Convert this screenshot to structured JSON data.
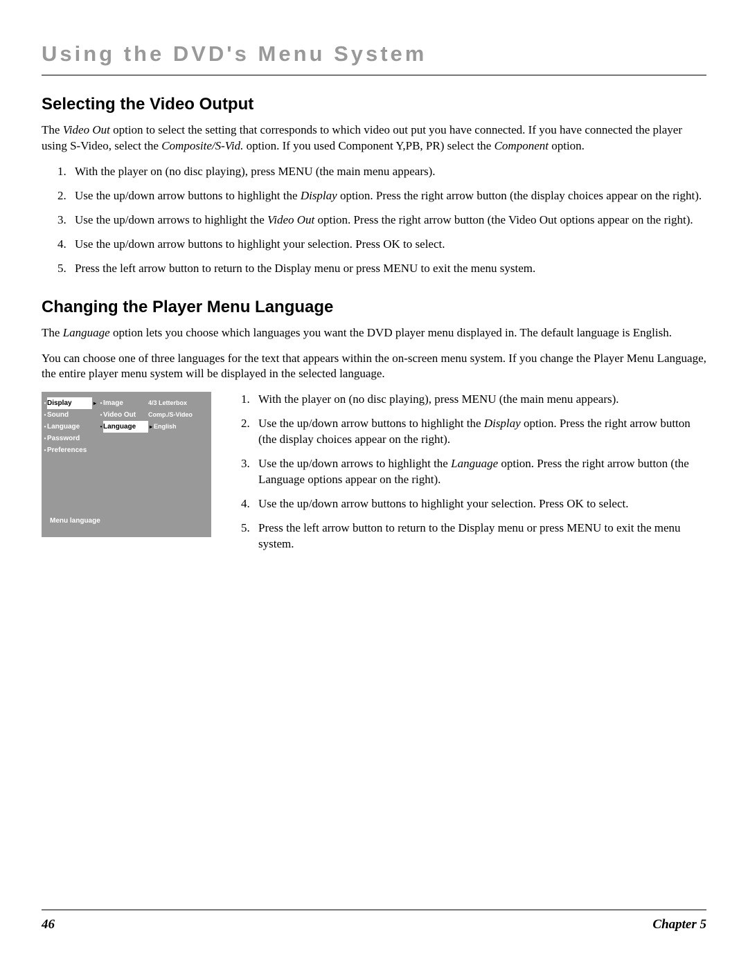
{
  "page_title": "Using the DVD's Menu System",
  "section1": {
    "heading": "Selecting the Video Output",
    "intro_pre": "The ",
    "intro_ital1": "Video Out",
    "intro_mid": " option to select the setting that corresponds to which video out put you have connected. If you have connected the player using S-Video, select the ",
    "intro_ital2": "Composite/S-Vid.",
    "intro_mid2": " option. If you used Component Y,PB, PR) select the ",
    "intro_ital3": "Component",
    "intro_end": " option.",
    "steps": {
      "s1": "With the player on (no disc playing), press MENU (the main menu appears).",
      "s2_a": "Use the up/down arrow buttons to highlight the ",
      "s2_i": "Display",
      "s2_b": " option. Press the right arrow button (the display choices appear on the right).",
      "s3_a": "Use the up/down arrows to highlight the ",
      "s3_i": "Video Out",
      "s3_b": " option. Press the right arrow button (the Video Out options appear on the right).",
      "s4": "Use the up/down arrow buttons to highlight your selection. Press OK to select.",
      "s5": "Press the left arrow button to return to the Display menu or press MENU to exit the menu system."
    }
  },
  "section2": {
    "heading": "Changing the Player Menu Language",
    "intro_pre": "The ",
    "intro_ital1": "Language",
    "intro_end": " option lets you choose which languages you want the DVD player menu displayed in. The default language is English.",
    "para2": "You can choose one of three languages for the text that appears within the on-screen menu system. If you change the Player Menu Language, the entire player menu system will be displayed in the selected language.",
    "steps": {
      "s1": "With the player on (no disc playing), press MENU (the main menu appears).",
      "s2_a": "Use the up/down arrow buttons to highlight the ",
      "s2_i": "Display",
      "s2_b": " option. Press the right arrow button (the display choices appear on the right).",
      "s3_a": "Use the up/down arrows to highlight the ",
      "s3_i": "Language",
      "s3_b": " option. Press the right arrow button (the Language options appear on the right).",
      "s4": "Use the up/down arrow buttons to highlight your selection. Press OK to select.",
      "s5": "Press the left arrow button to return to the Display menu or press MENU to exit the menu system."
    }
  },
  "diagram": {
    "left": {
      "r1": "Display",
      "r2": "Sound",
      "r3": "Language",
      "r4": "Password",
      "r5": "Preferences"
    },
    "mid": {
      "r1": "Image",
      "r2": "Video Out",
      "r3": "Language"
    },
    "right": {
      "r1": "4/3 Letterbox",
      "r2": "Comp./S-Video",
      "r3": "English"
    },
    "label": "Menu language",
    "bullet": "•",
    "arrow": "▸"
  },
  "footer": {
    "page": "46",
    "chapter": "Chapter 5"
  }
}
